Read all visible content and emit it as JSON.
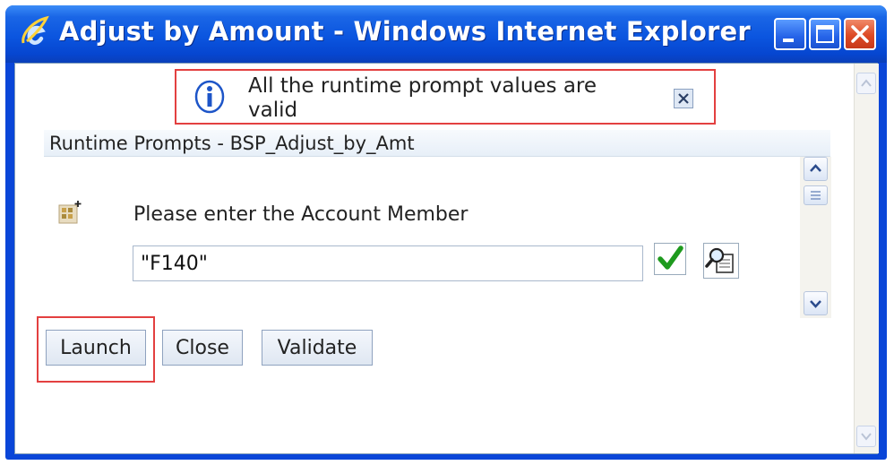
{
  "window": {
    "title": "Adjust by Amount - Windows Internet Explorer",
    "controls": [
      "minimize-icon",
      "maximize-icon",
      "close-icon"
    ]
  },
  "info": {
    "message": "All the runtime prompt values are valid",
    "icon": "info-icon",
    "close_icon": "close-icon"
  },
  "section": {
    "title": "Runtime Prompts - BSP_Adjust_by_Amt"
  },
  "prompt": {
    "label": "Please enter the Account Member",
    "value": "\"F140\"",
    "validate_icon": "checkmark-icon",
    "lookup_icon": "member-lookup-icon",
    "member_icon": "member-selector-icon"
  },
  "buttons": {
    "launch": "Launch",
    "close": "Close",
    "validate": "Validate"
  },
  "colors": {
    "titlebar": "#0b55df",
    "highlight_border": "#e34040",
    "check_green": "#1e9a1e"
  }
}
